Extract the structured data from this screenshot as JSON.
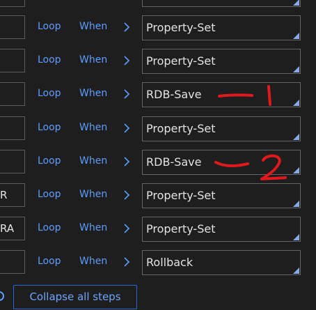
{
  "steps": [
    {
      "left_value": "",
      "loop_label": "Loop",
      "when_label": "When",
      "method": "Property-Set"
    },
    {
      "left_value": "",
      "loop_label": "Loop",
      "when_label": "When",
      "method": "Property-Set"
    },
    {
      "left_value": "",
      "loop_label": "Loop",
      "when_label": "When",
      "method": "RDB-Save"
    },
    {
      "left_value": "",
      "loop_label": "Loop",
      "when_label": "When",
      "method": "Property-Set"
    },
    {
      "left_value": "",
      "loop_label": "Loop",
      "when_label": "When",
      "method": "RDB-Save"
    },
    {
      "left_value": "R",
      "loop_label": "Loop",
      "when_label": "When",
      "method": "Property-Set"
    },
    {
      "left_value": "RA",
      "loop_label": "Loop",
      "when_label": "When",
      "method": "Property-Set"
    },
    {
      "left_value": "",
      "loop_label": "Loop",
      "when_label": "When",
      "method": "Rollback"
    }
  ],
  "annotations": [
    "1",
    "2"
  ],
  "collapse_button_label": "Collapse all steps",
  "colors": {
    "background": "#1e1e1f",
    "link": "#5f9dff",
    "field_border": "#646464",
    "corner": "#8aa8e6",
    "annotation": "#e0191f"
  },
  "icons": {
    "chevron": "chevron-right-icon",
    "resize": "resize-corner-icon",
    "radio": "radio-icon"
  }
}
